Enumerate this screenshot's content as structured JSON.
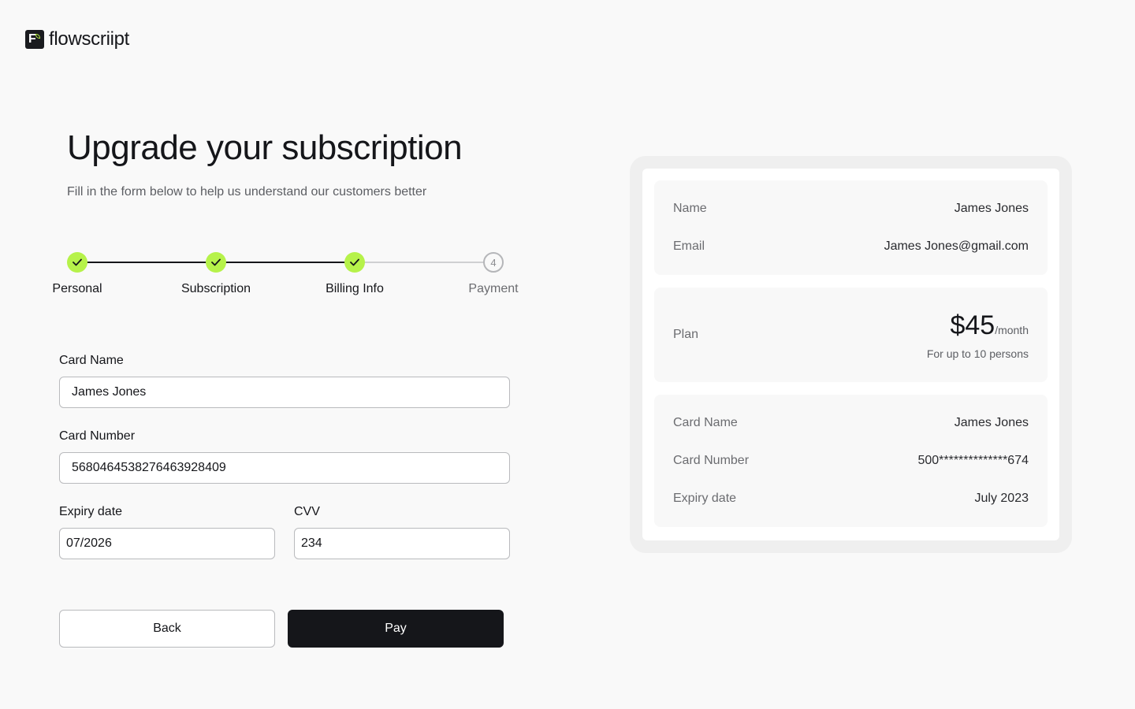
{
  "brand": {
    "name": "flowscriipt",
    "mark": "F",
    "accent": "#b6f24a"
  },
  "header": {
    "title": "Upgrade your subscription",
    "subtitle": "Fill in the form below to help us understand our customers better"
  },
  "stepper": {
    "steps": [
      {
        "label": "Personal",
        "state": "done"
      },
      {
        "label": "Subscription",
        "state": "done"
      },
      {
        "label": "Billing Info",
        "state": "done"
      },
      {
        "label": "Payment",
        "state": "todo",
        "number": "4"
      }
    ]
  },
  "form": {
    "card_name": {
      "label": "Card Name",
      "value": "James Jones"
    },
    "card_number": {
      "label": "Card Number",
      "value": "5680464538276463928409"
    },
    "expiry": {
      "label": "Expiry date",
      "value": "07/2026"
    },
    "cvv": {
      "label": "CVV",
      "value": "234"
    }
  },
  "actions": {
    "back_label": "Back",
    "pay_label": "Pay"
  },
  "summary": {
    "name": {
      "label": "Name",
      "value": "James Jones"
    },
    "email": {
      "label": "Email",
      "value": "James Jones@gmail.com"
    },
    "plan": {
      "label": "Plan",
      "price": "$45",
      "period": "/month",
      "note": "For up to 10 persons"
    },
    "card_name": {
      "label": "Card Name",
      "value": "James Jones"
    },
    "card_number": {
      "label": "Card Number",
      "value": "500**************674"
    },
    "expiry": {
      "label": "Expiry date",
      "value": "July 2023"
    }
  }
}
